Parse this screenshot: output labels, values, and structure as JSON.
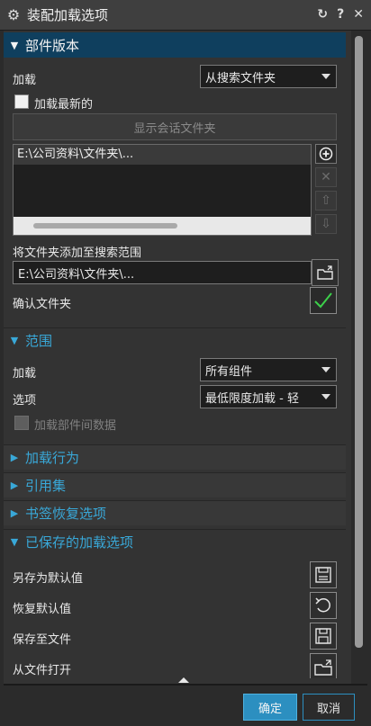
{
  "window": {
    "title": "装配加载选项",
    "icons": [
      "gear-icon",
      "reset-icon",
      "help-icon",
      "close-icon"
    ]
  },
  "sections": {
    "part_version": {
      "title": "部件版本",
      "load_label": "加载",
      "load_value": "从搜索文件夹",
      "load_latest_label": "加载最新的",
      "load_latest_checked": false,
      "show_session_folder_label": "显示会话文件夹",
      "folder_list": [
        "E:\\公司资料\\文件夹\\..."
      ],
      "add_folder_label": "将文件夹添加至搜索范围",
      "add_folder_value": "E:\\公司资料\\文件夹\\...",
      "confirm_folder_label": "确认文件夹"
    },
    "scope": {
      "title": "范围",
      "load_label": "加载",
      "load_value": "所有组件",
      "options_label": "选项",
      "options_value": "最低限度加载 - 轻",
      "load_interpart_label": "加载部件间数据",
      "load_interpart_checked": false
    },
    "load_behavior": {
      "title": "加载行为"
    },
    "reference_sets": {
      "title": "引用集"
    },
    "bookmark_restore": {
      "title": "书签恢复选项"
    },
    "saved_options": {
      "title": "已保存的加载选项",
      "save_default_label": "另存为默认值",
      "restore_default_label": "恢复默认值",
      "save_to_file_label": "保存至文件",
      "open_from_file_label": "从文件打开"
    }
  },
  "footer": {
    "ok_label": "确定",
    "cancel_label": "取消"
  },
  "colors": {
    "accent": "#2c8fc0",
    "section_title": "#39a8d8",
    "header_dark": "#0f3f5e",
    "check_green": "#3cd04a"
  }
}
